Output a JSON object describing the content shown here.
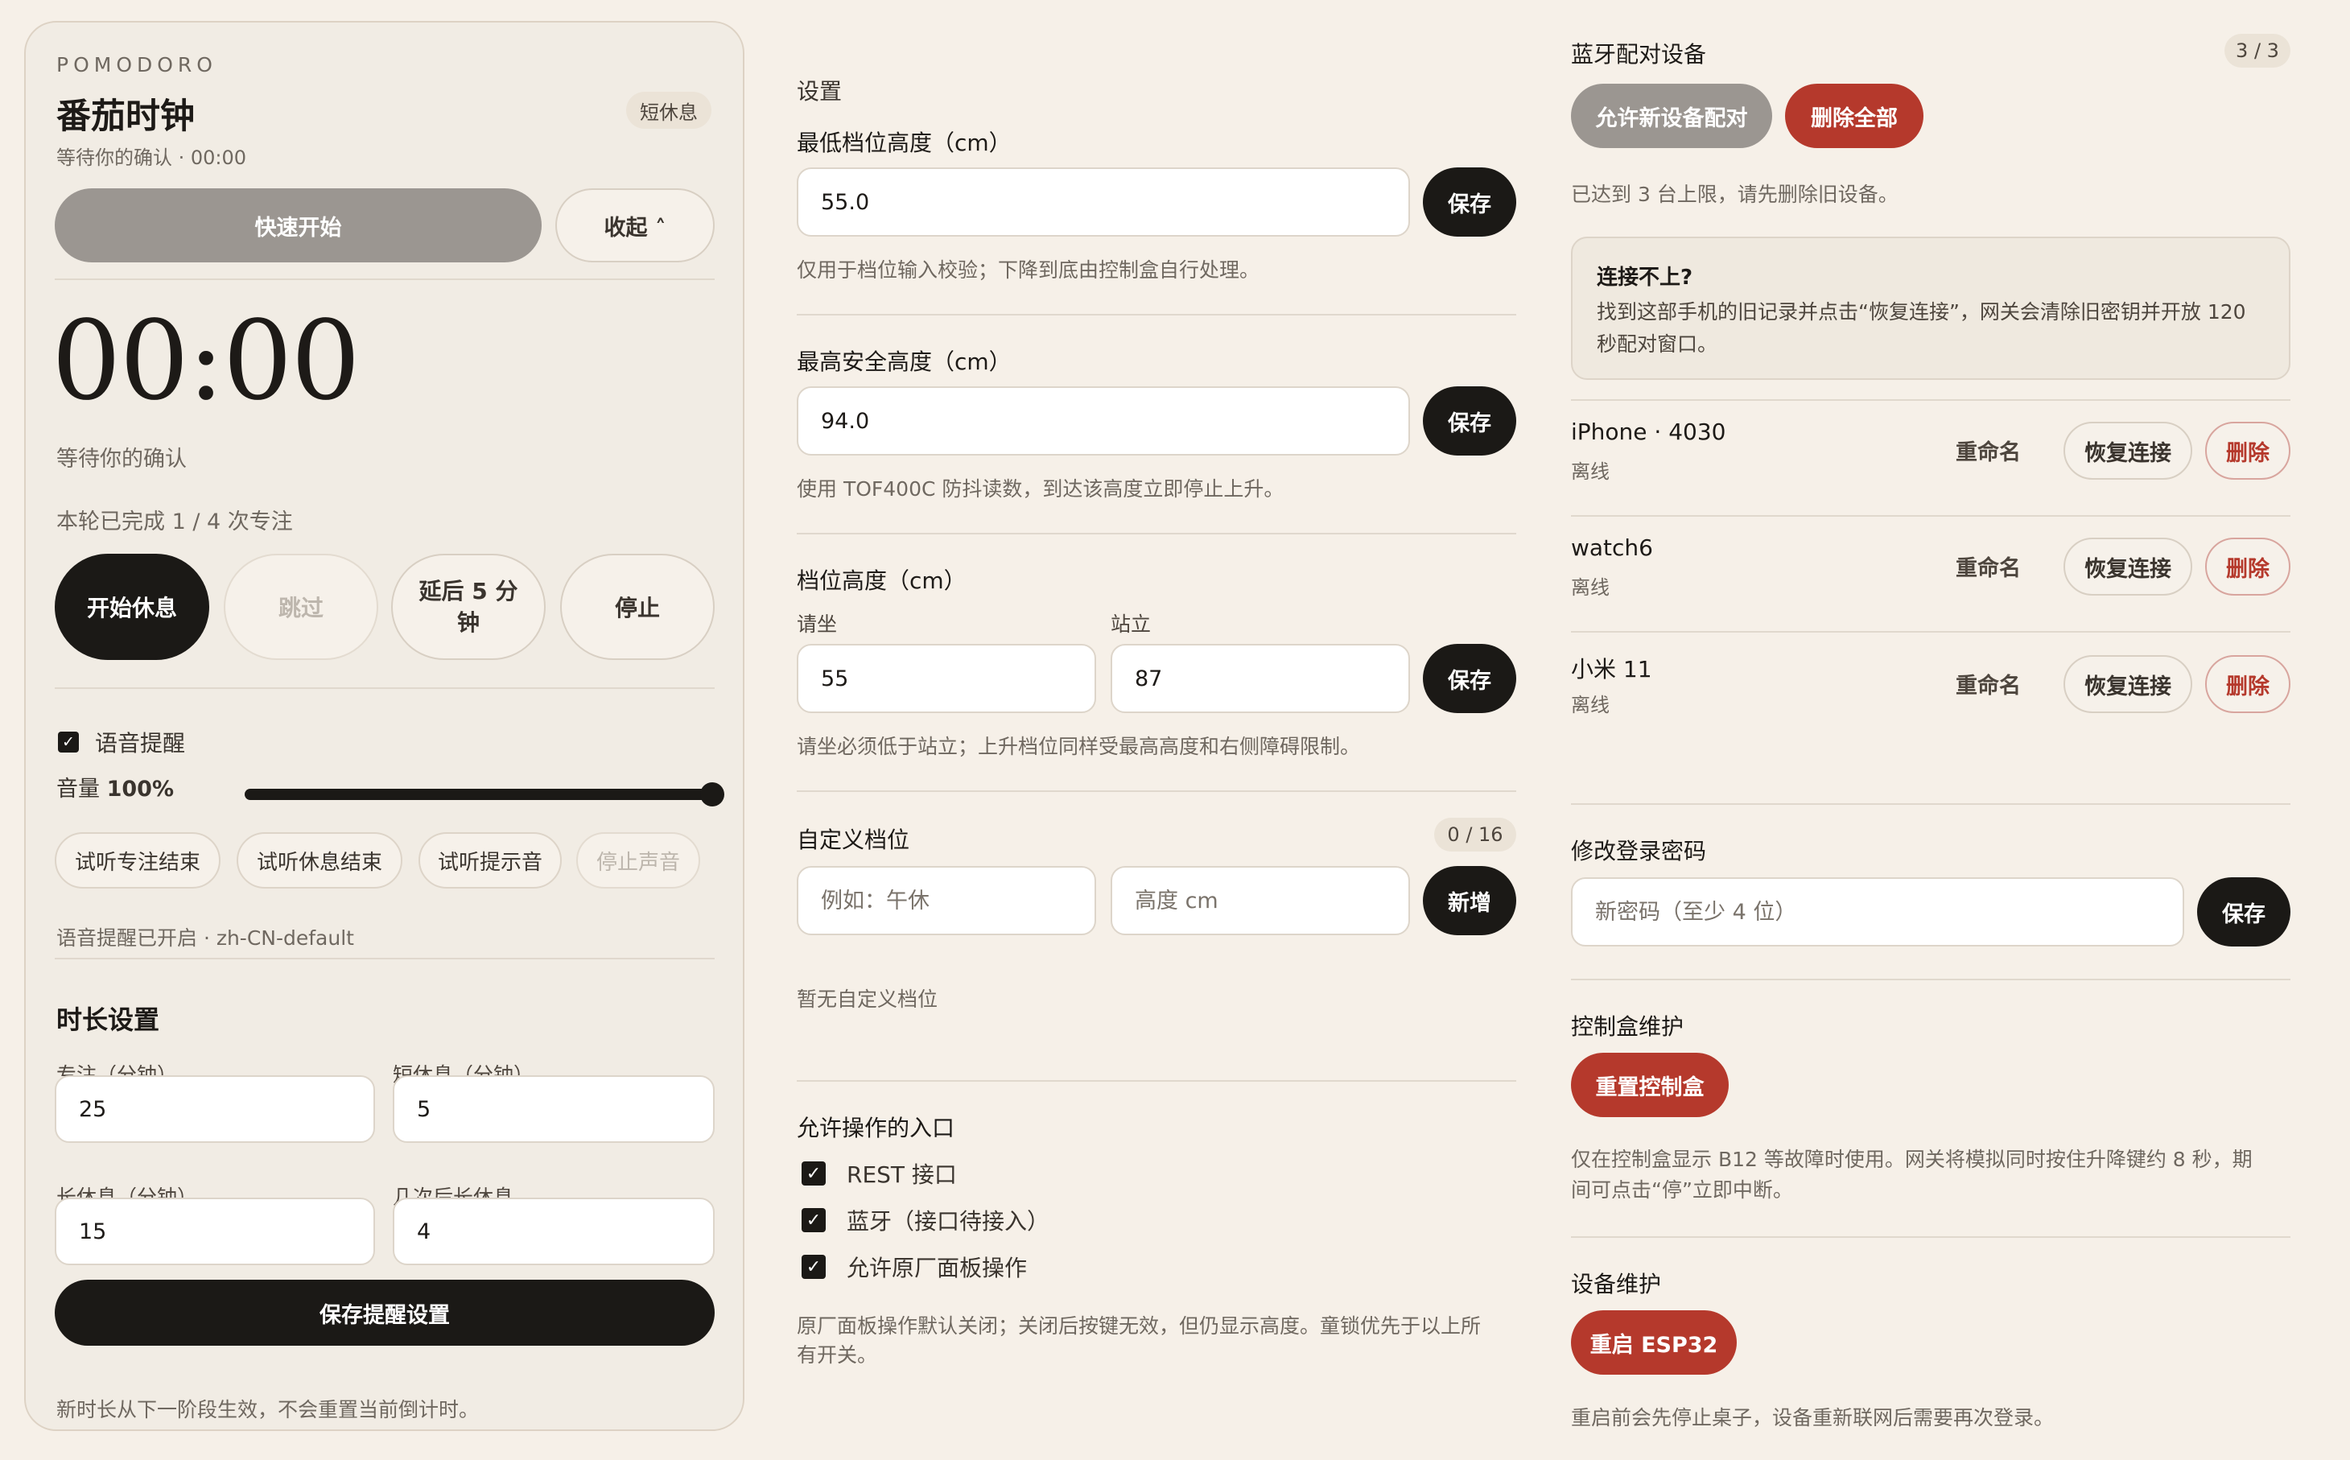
{
  "pomodoro": {
    "eyebrow": "POMODORO",
    "title": "番茄时钟",
    "status_badge": "短休息",
    "subtitle": "等待你的确认 · 00:00",
    "quick_start": "快速开始",
    "collapse": "收起 ˄",
    "timer": "00:00",
    "timer_status": "等待你的确认",
    "round_progress": "本轮已完成 1 / 4 次专注",
    "actions": {
      "start_break": "开始休息",
      "skip": "跳过",
      "delay_line1": "延后 5 分",
      "delay_line2": "钟",
      "stop": "停止"
    },
    "voice": {
      "checkbox_label": "语音提醒",
      "volume_label": "音量",
      "volume_value": "100%",
      "volume_level": 1.0,
      "chips": [
        "试听专注结束",
        "试听休息结束",
        "试听提示音",
        "停止声音"
      ],
      "status": "语音提醒已开启 · zh-CN-default"
    },
    "duration": {
      "heading": "时长设置",
      "focus_label": "专注（分钟）",
      "focus_value": "25",
      "short_label": "短休息（分钟）",
      "short_value": "5",
      "long_label": "长休息（分钟）",
      "long_value": "15",
      "cycles_label": "几次后长休息",
      "cycles_value": "4",
      "save": "保存提醒设置",
      "note": "新时长从下一阶段生效，不会重置当前倒计时。"
    }
  },
  "settings": {
    "heading": "设置",
    "min_height": {
      "label": "最低档位高度（cm）",
      "value": "55.0",
      "save": "保存",
      "hint": "仅用于档位输入校验；下降到底由控制盒自行处理。"
    },
    "max_height": {
      "label": "最高安全高度（cm）",
      "value": "94.0",
      "save": "保存",
      "hint": "使用 TOF400C 防抖读数，到达该高度立即停止上升。"
    },
    "presets": {
      "label": "档位高度（cm）",
      "sit_label": "请坐",
      "sit_value": "55",
      "stand_label": "站立",
      "stand_value": "87",
      "save": "保存",
      "hint": "请坐必须低于站立；上升档位同样受最高高度和右侧障碍限制。"
    },
    "custom": {
      "label": "自定义档位",
      "count": "0 / 16",
      "name_placeholder": "例如：午休",
      "height_placeholder": "高度 cm",
      "add": "新增",
      "empty": "暂无自定义档位"
    },
    "entries": {
      "label": "允许操作的入口",
      "items": [
        "REST 接口",
        "蓝牙（接口待接入）",
        "允许原厂面板操作"
      ],
      "hint_line1": "原厂面板操作默认关闭；关闭后按键无效，但仍显示高度。童锁优先于以上所",
      "hint_line2": "有开关。"
    }
  },
  "bluetooth": {
    "heading": "蓝牙配对设备",
    "count": "3 / 3",
    "allow_pair": "允许新设备配对",
    "delete_all": "删除全部",
    "limit_note": "已达到 3 台上限，请先删除旧设备。",
    "help": {
      "title": "连接不上?",
      "line1": "找到这部手机的旧记录并点击“恢复连接”，网关会清除旧密钥并开放 120",
      "line2": "秒配对窗口。"
    },
    "rename": "重命名",
    "reconnect": "恢复连接",
    "delete": "删除",
    "devices": [
      {
        "name": "iPhone · 4030",
        "status": "离线"
      },
      {
        "name": "watch6",
        "status": "离线"
      },
      {
        "name": "小米 11",
        "status": "离线"
      }
    ]
  },
  "password": {
    "heading": "修改登录密码",
    "placeholder": "新密码（至少 4 位）",
    "save": "保存"
  },
  "controller": {
    "heading": "控制盒维护",
    "reset": "重置控制盒",
    "note_line1": "仅在控制盒显示 B12 等故障时使用。网关将模拟同时按住升降键约 8 秒，期",
    "note_line2": "间可点击“停”立即中断。"
  },
  "device_maint": {
    "heading": "设备维护",
    "reboot": "重启 ESP32",
    "note": "重启前会先停止桌子，设备重新联网后需要再次登录。"
  },
  "colors": {
    "background": "#f6f0e8",
    "dark": "#1b1916",
    "danger": "#b5392c",
    "disabled": "#9b9691"
  }
}
